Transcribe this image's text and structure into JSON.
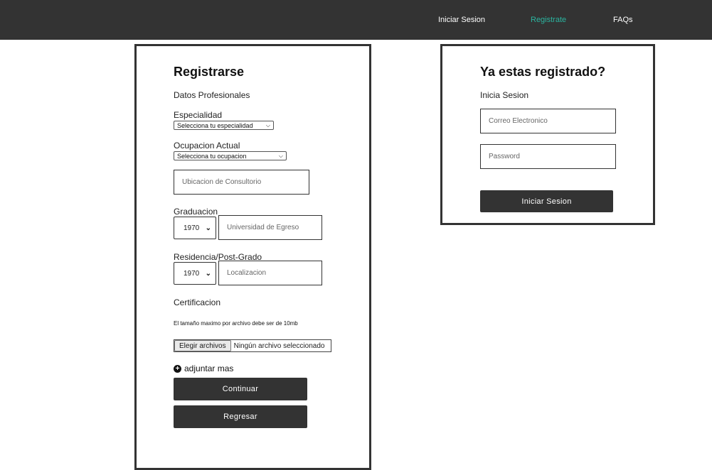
{
  "nav": {
    "login": "Iniciar Sesion",
    "register": "Registrate",
    "faqs": "FAQs",
    "active_color": "#2bb5a0",
    "bar_color": "#333333"
  },
  "register": {
    "title": "Registrarse",
    "section": "Datos Profesionales",
    "specialty_label": "Especialidad",
    "specialty_value": "Selecciona tu especialidad",
    "occupation_label": "Ocupacion Actual",
    "occupation_value": "Selecciona tu ocupacion",
    "office_placeholder": "Ubicacion de Consultorio",
    "graduation_label": "Graduacion",
    "graduation_year": "1970",
    "university_placeholder": "Universidad de Egreso",
    "residency_label": "Residencia/Post-Grado",
    "residency_year": "1970",
    "location_placeholder": "Localizacion",
    "certification_label": "Certificacion",
    "file_note": "El tamaño maximo por archivo debe ser de 10mb",
    "file_button": "Elegir archivos",
    "file_status": "Ningún archivo seleccionado",
    "add_more": "adjuntar mas",
    "continue_button": "Continuar",
    "back_button": "Regresar"
  },
  "login": {
    "title": "Ya estas registrado?",
    "subtitle": "Inicia Sesion",
    "email_placeholder": "Correo Electronico",
    "password_placeholder": "Password",
    "submit_button": "Iniciar Sesion"
  }
}
